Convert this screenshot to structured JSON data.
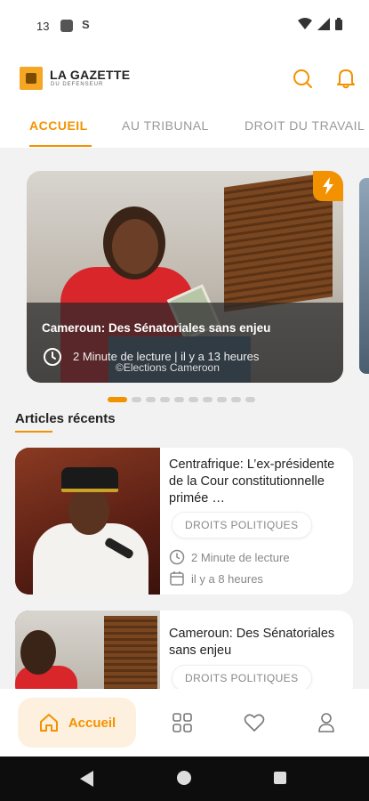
{
  "status_bar": {
    "time": "13",
    "notif_icon_2": "S",
    "icons": [
      "wifi-icon",
      "signal-icon",
      "battery-icon"
    ]
  },
  "app_bar": {
    "logo_title": "LA GAZETTE",
    "logo_subtitle": "DU DEFENSEUR",
    "icons": [
      "search-icon",
      "bell-icon"
    ]
  },
  "tabs": [
    {
      "label": "ACCUEIL",
      "active": true
    },
    {
      "label": "AU TRIBUNAL",
      "active": false
    },
    {
      "label": "DROIT DU TRAVAIL",
      "active": false
    }
  ],
  "hero": {
    "title": "Cameroun: Des Sénatoriales sans enjeu",
    "meta": "2  Minute de lecture | il y a 13 heures",
    "credit": "©Elections Cameroon",
    "badge_icon": "flash-icon"
  },
  "carousel": {
    "count": 10,
    "active_index": 0
  },
  "section": {
    "title": "Articles récents"
  },
  "articles": [
    {
      "title": "Centrafrique: L’ex-présidente de la Cour constitutionnelle primée …",
      "category": "DROITS POLITIQUES",
      "read_time": "2 Minute de lecture",
      "published": "il y a 8 heures"
    },
    {
      "title": "Cameroun: Des Sénatoriales sans enjeu",
      "category": "DROITS POLITIQUES"
    }
  ],
  "bottom_nav": {
    "home_label": "Accueil",
    "items": [
      "home-icon",
      "grid-icon",
      "heart-icon",
      "profile-icon"
    ]
  },
  "colors": {
    "accent": "#f39200",
    "background": "#f2f2f2"
  }
}
